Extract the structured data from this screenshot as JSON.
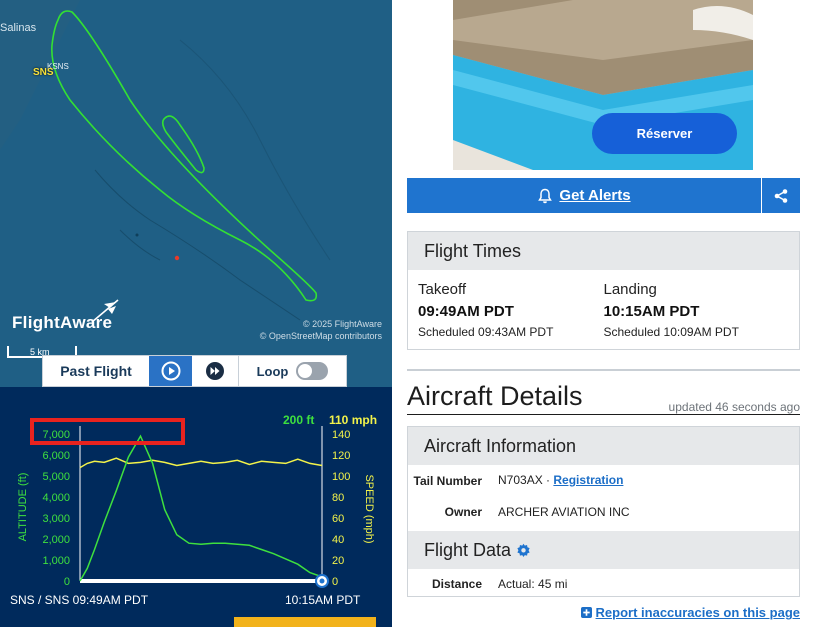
{
  "map": {
    "city_label": "Salinas",
    "airport_code_small": "KSNS",
    "airport_code": "SNS",
    "logo_text": "FlightAware",
    "credit_line1": "© 2025 FlightAware",
    "credit_line2": "© OpenStreetMap contributors",
    "scale_label": "5 km",
    "colors": {
      "water": "#1f5f85",
      "track": "#33e033"
    }
  },
  "playback": {
    "mode_label": "Past Flight",
    "loop_label": "Loop",
    "loop_enabled": false,
    "play_icon": "play-icon",
    "fast_forward_icon": "fast-forward-icon"
  },
  "graph": {
    "current_altitude": "200 ft",
    "current_speed": "110 mph",
    "from_label": "SNS / SNS 09:49AM PDT",
    "to_label": "10:15AM PDT",
    "altitude_axis_label": "ALTITUDE (ft)",
    "speed_axis_label": "SPEED (mph)",
    "altitude_ticks": [
      "0",
      "1,000",
      "2,000",
      "3,000",
      "4,000",
      "5,000",
      "6,000",
      "7,000"
    ],
    "speed_ticks": [
      "0",
      "20",
      "40",
      "60",
      "80",
      "100",
      "120",
      "140"
    ],
    "colors": {
      "background": "#002a5c",
      "altitude": "#3ee03e",
      "speed": "#f3f34a",
      "highlight": "#e8231f"
    }
  },
  "chart_data": {
    "type": "line",
    "xlabel": "",
    "ylabel": "ALTITUDE (ft)",
    "y2label": "SPEED (mph)",
    "ylim": [
      0,
      7000
    ],
    "y2lim": [
      0,
      140
    ],
    "x": [
      0,
      0.03,
      0.06,
      0.1,
      0.15,
      0.2,
      0.25,
      0.3,
      0.35,
      0.4,
      0.45,
      0.5,
      0.55,
      0.6,
      0.65,
      0.7,
      0.75,
      0.8,
      0.85,
      0.9,
      0.95,
      1.0
    ],
    "series": [
      {
        "name": "ALTITUDE (ft)",
        "values": [
          0,
          600,
          1500,
          2800,
          4300,
          5900,
          6900,
          5600,
          3400,
          2200,
          1800,
          1750,
          1800,
          1800,
          1750,
          1700,
          1500,
          1300,
          1050,
          800,
          400,
          200
        ]
      },
      {
        "name": "SPEED (mph)",
        "values": [
          108,
          112,
          114,
          113,
          117,
          112,
          113,
          115,
          113,
          110,
          112,
          114,
          112,
          113,
          115,
          111,
          114,
          113,
          112,
          116,
          112,
          110
        ]
      }
    ]
  },
  "ad": {
    "button_label": "Réserver"
  },
  "alerts": {
    "label": "Get Alerts"
  },
  "flight_times": {
    "title": "Flight Times",
    "takeoff_label": "Takeoff",
    "takeoff_time": "09:49AM PDT",
    "takeoff_scheduled": "Scheduled 09:43AM PDT",
    "landing_label": "Landing",
    "landing_time": "10:15AM PDT",
    "landing_scheduled": "Scheduled 10:09AM PDT"
  },
  "aircraft": {
    "title": "Aircraft Details",
    "updated": "updated 46 seconds ago",
    "info_title": "Aircraft Information",
    "tail_label": "Tail Number",
    "tail_value": "N703AX",
    "tail_separator": "·",
    "registration_link": "Registration",
    "owner_label": "Owner",
    "owner_value": "ARCHER AVIATION INC",
    "flight_data_title": "Flight Data",
    "distance_label": "Distance",
    "distance_value": "Actual: 45 mi"
  },
  "report_link": "Report inaccuracies on this page"
}
